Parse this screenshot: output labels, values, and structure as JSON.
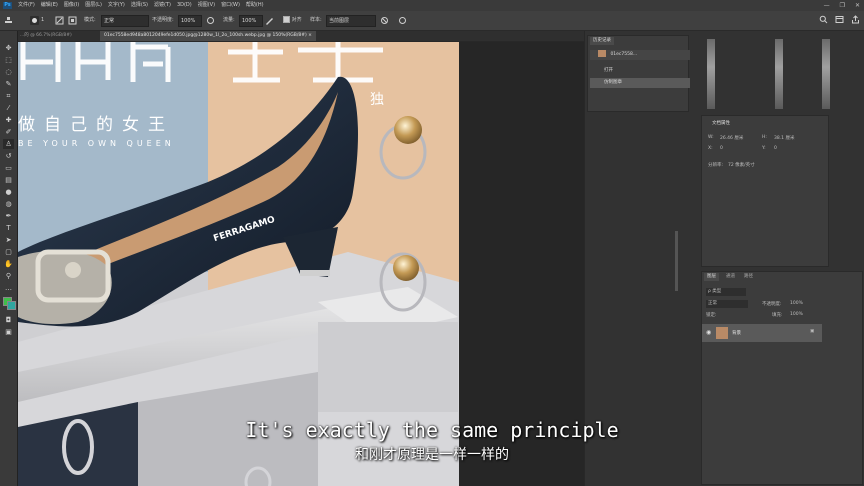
{
  "menubar": {
    "logo": "Ps",
    "items": [
      "文件(F)",
      "编辑(E)",
      "图像(I)",
      "图层(L)",
      "文字(Y)",
      "选择(S)",
      "滤镜(T)",
      "3D(D)",
      "视图(V)",
      "窗口(W)",
      "帮助(H)"
    ],
    "window_controls": [
      "—",
      "❐",
      "✕"
    ]
  },
  "optionbar": {
    "brush_size": "1",
    "mode_label": "模式:",
    "mode_value": "正常",
    "opacity_label": "不透明度:",
    "opacity_value": "100%",
    "flow_label": "流量:",
    "flow_value": "100%",
    "align_label": "对齐",
    "sample_label": "样本:",
    "sample_value": "当前图层"
  },
  "document": {
    "left_tab": "...的 @ 66.7%(RGB/8#)",
    "active_tab": "01ec7558ed948a8012049efe1d050.jpg@1280w_1l_2o_100sh.webp.jpg @ 150%(RGB/8#) ×"
  },
  "poster": {
    "big_title": "做自己的女王",
    "cn_title": "做自己的女王",
    "en_title": "BE YOUR OWN QUEEN",
    "side_char": "独",
    "brand_on_shoe": "FERRAGAMO",
    "shoe_colors": {
      "body": "#1d2a3a",
      "lining": "#c89c74"
    },
    "bg_left": "#9fb5c6",
    "bg_right": "#e7c3a2"
  },
  "history_panel": {
    "title": "历史记录",
    "snapshot": "01ec7558...",
    "items": [
      "打开",
      "仿制图章"
    ]
  },
  "properties_panel": {
    "title": "文档属性",
    "w_label": "W:",
    "w_value": "26.46 厘米",
    "h_label": "H:",
    "h_value": "38.1 厘米",
    "x_label": "X:",
    "x_value": "0",
    "y_label": "Y:",
    "y_value": "0",
    "res_label": "分辨率:",
    "res_value": "72 像素/英寸"
  },
  "layers_panel": {
    "tabs": [
      "图层",
      "通道",
      "路径"
    ],
    "kind_label": "ρ 类型",
    "blend_mode": "正常",
    "opacity_label": "不透明度:",
    "opacity_value": "100%",
    "lock_label": "锁定:",
    "fill_label": "填充:",
    "fill_value": "100%",
    "layer_name": "背景"
  },
  "subtitles": {
    "english": "It's exactly the same principle",
    "chinese": "和刚才原理是一样一样的"
  }
}
